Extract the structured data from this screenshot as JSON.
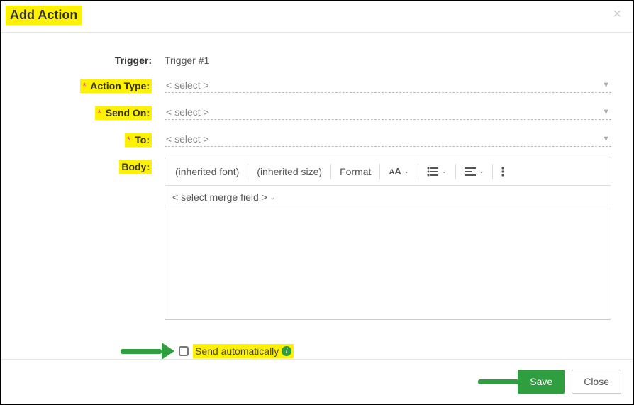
{
  "header": {
    "title": "Add Action"
  },
  "form": {
    "trigger": {
      "label": "Trigger:",
      "value": "Trigger #1"
    },
    "action_type": {
      "label": "Action Type:",
      "placeholder": "< select >"
    },
    "send_on": {
      "label": "Send On:",
      "placeholder": "< select >"
    },
    "to": {
      "label": "To:",
      "placeholder": "< select >"
    },
    "body": {
      "label": "Body:"
    }
  },
  "editor": {
    "inherited_font": "(inherited font)",
    "inherited_size": "(inherited size)",
    "format_label": "Format",
    "merge_placeholder": "< select merge field >"
  },
  "checkbox": {
    "send_auto_label": "Send automatically"
  },
  "footer": {
    "save_label": "Save",
    "close_label": "Close"
  }
}
